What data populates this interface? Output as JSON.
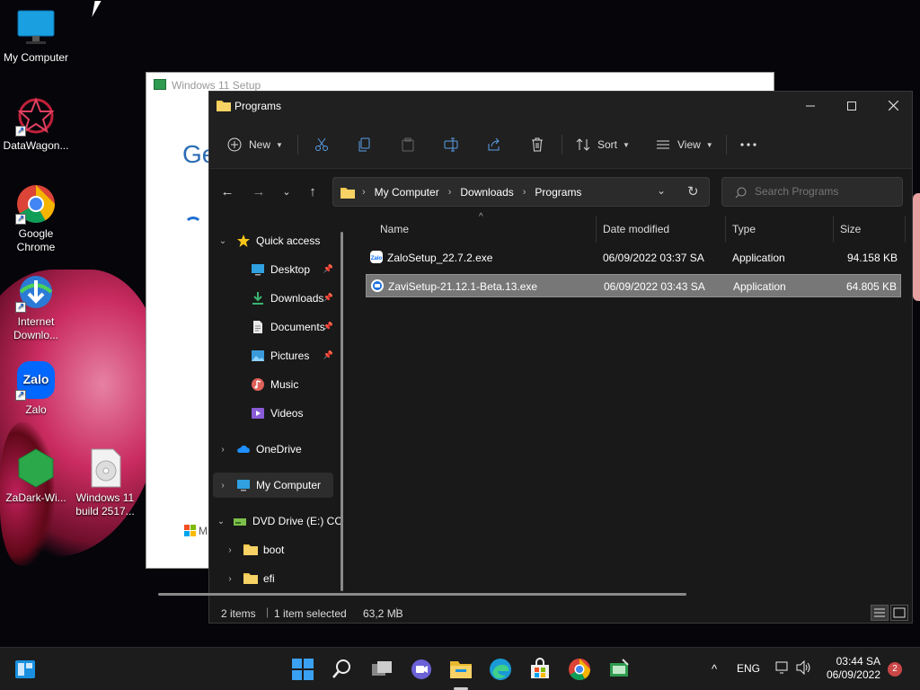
{
  "desktop": {
    "icons": [
      {
        "label": "My Computer"
      },
      {
        "label": "DataWagon..."
      },
      {
        "label": "Google Chrome"
      },
      {
        "label": "Internet Downlo..."
      },
      {
        "label": "Zalo"
      },
      {
        "label": "ZaDark-Wi..."
      },
      {
        "label": "Windows 11 build 2517..."
      }
    ]
  },
  "setup_window": {
    "title": "Windows 11 Setup",
    "heading": "Ge",
    "footer": "M"
  },
  "explorer": {
    "title": "Programs",
    "toolbar": {
      "new_label": "New",
      "sort_label": "Sort",
      "view_label": "View"
    },
    "breadcrumb": [
      "My Computer",
      "Downloads",
      "Programs"
    ],
    "search_placeholder": "Search Programs",
    "sidebar": [
      {
        "label": "Quick access"
      },
      {
        "label": "Desktop"
      },
      {
        "label": "Downloads"
      },
      {
        "label": "Documents"
      },
      {
        "label": "Pictures"
      },
      {
        "label": "Music"
      },
      {
        "label": "Videos"
      },
      {
        "label": "OneDrive"
      },
      {
        "label": "My Computer"
      },
      {
        "label": "DVD Drive (E:) CC"
      },
      {
        "label": "boot"
      },
      {
        "label": "efi"
      }
    ],
    "columns": {
      "name": "Name",
      "date": "Date modified",
      "type": "Type",
      "size": "Size"
    },
    "files": [
      {
        "name": "ZaloSetup_22.7.2.exe",
        "date": "06/09/2022 03:37 SA",
        "type": "Application",
        "size": "94.158 KB"
      },
      {
        "name": "ZaviSetup-21.12.1-Beta.13.exe",
        "date": "06/09/2022 03:43 SA",
        "type": "Application",
        "size": "64.805 KB"
      }
    ],
    "status": {
      "items": "2 items",
      "selected": "1 item selected",
      "size": "63,2 MB"
    }
  },
  "taskbar": {
    "language": "ENG",
    "time": "03:44 SA",
    "date": "06/09/2022",
    "notifications": "2"
  }
}
